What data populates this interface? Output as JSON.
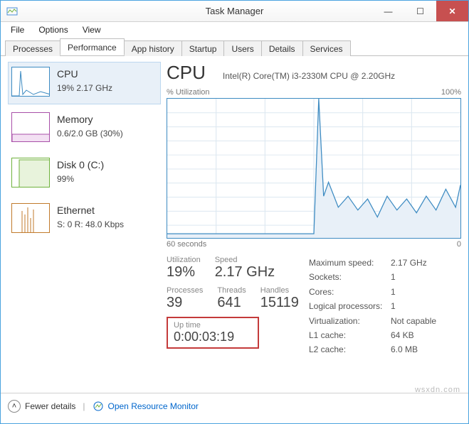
{
  "window": {
    "title": "Task Manager"
  },
  "menu": {
    "file": "File",
    "options": "Options",
    "view": "View"
  },
  "tabs": {
    "processes": "Processes",
    "performance": "Performance",
    "app_history": "App history",
    "startup": "Startup",
    "users": "Users",
    "details": "Details",
    "services": "Services"
  },
  "sidebar": {
    "cpu": {
      "title": "CPU",
      "sub": "19% 2.17 GHz",
      "color": "#3d8bc2"
    },
    "memory": {
      "title": "Memory",
      "sub": "0.6/2.0 GB (30%)",
      "color": "#a84fa8"
    },
    "disk": {
      "title": "Disk 0 (C:)",
      "sub": "99%",
      "color": "#6fb23c"
    },
    "ethernet": {
      "title": "Ethernet",
      "sub": "S: 0 R: 48.0 Kbps",
      "color": "#c17a2b"
    }
  },
  "main": {
    "title": "CPU",
    "subtitle": "Intel(R) Core(TM) i3-2330M CPU @ 2.20GHz",
    "chart_top_left": "% Utilization",
    "chart_top_right": "100%",
    "chart_bottom_left": "60 seconds",
    "chart_bottom_right": "0",
    "utilization_label": "Utilization",
    "utilization_value": "19%",
    "speed_label": "Speed",
    "speed_value": "2.17 GHz",
    "processes_label": "Processes",
    "processes_value": "39",
    "threads_label": "Threads",
    "threads_value": "641",
    "handles_label": "Handles",
    "handles_value": "15119",
    "uptime_label": "Up time",
    "uptime_value": "0:00:03:19",
    "kv": {
      "max_speed_label": "Maximum speed:",
      "max_speed_value": "2.17 GHz",
      "sockets_label": "Sockets:",
      "sockets_value": "1",
      "cores_label": "Cores:",
      "cores_value": "1",
      "lp_label": "Logical processors:",
      "lp_value": "1",
      "virt_label": "Virtualization:",
      "virt_value": "Not capable",
      "l1_label": "L1 cache:",
      "l1_value": "64 KB",
      "l2_label": "L2 cache:",
      "l2_value": "6.0 MB"
    }
  },
  "footer": {
    "fewer": "Fewer details",
    "open_mon": "Open Resource Monitor"
  },
  "watermark": "wsxdn.com",
  "chart_data": {
    "type": "line",
    "title": "% Utilization",
    "xlabel": "seconds",
    "ylabel": "% Utilization",
    "xlim": [
      0,
      60
    ],
    "ylim": [
      0,
      100
    ],
    "x": [
      0,
      5,
      10,
      15,
      20,
      25,
      28,
      29,
      30,
      31,
      32,
      33,
      35,
      37,
      39,
      41,
      43,
      45,
      47,
      49,
      51,
      53,
      55,
      57,
      59,
      60
    ],
    "values": [
      3,
      3,
      3,
      3,
      3,
      3,
      3,
      3,
      3,
      100,
      30,
      40,
      22,
      30,
      20,
      28,
      15,
      30,
      20,
      28,
      18,
      30,
      20,
      35,
      22,
      38
    ]
  }
}
